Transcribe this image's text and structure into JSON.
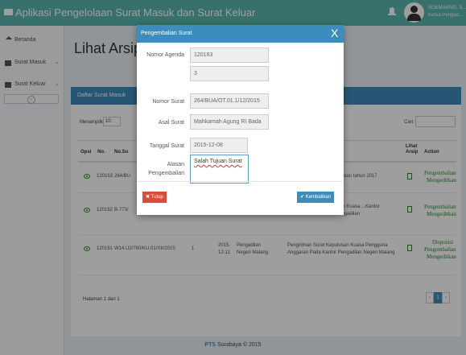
{
  "navbar": {
    "title": "Aplikasi Pengelolaan Surat Masuk dan Surat Keluar",
    "user_name": "SOEMARNO, S....",
    "user_role": "Ketua Pengad..."
  },
  "sidebar": {
    "items": [
      {
        "label": "Beranda"
      },
      {
        "label": "Surat Masuk"
      },
      {
        "label": "Surat Keluar"
      }
    ],
    "toggle": "‹"
  },
  "content": {
    "title": "Lihat Arsip M",
    "box_title": "Daftar Surat Masuk",
    "show_label": "Menampilkan",
    "show_value": "10",
    "search_label": "Cari:",
    "columns": [
      "Opsi",
      "No.",
      "No.Su",
      "Lihat Arsip",
      "Action"
    ],
    "rows": [
      {
        "no": "120163",
        "nomor": "264/BU",
        "perihal": "...gatan tahun 2017",
        "actions": [
          "Pengembalian",
          "Mengeditkan"
        ]
      },
      {
        "no": "120162",
        "nomor": "B-773/",
        "perihal": "...an Kuasa ...Kantor Pengadilan",
        "actions": [
          "Pengembalian",
          "Mengeditkan"
        ]
      },
      {
        "no": "120161",
        "nomor": "W14.U2/760/KU.01/XII/2015",
        "count": "1",
        "date": "2015-12-11",
        "asal": "Pengadilan Negeri Malang",
        "perihal": "Pengiriman Surat Keputusan Kuasa Pengguna Anggaran Pada Kantor Pengadilan Negeri Malang",
        "actions": [
          "Disposisi",
          "Pengembalian",
          "Mengeditkan"
        ]
      }
    ],
    "pager_info": "Halaman 1 dari 1",
    "pager_prev": "‹",
    "pager_current": "1",
    "pager_next": "›"
  },
  "footer": {
    "brand": "PTS",
    "text": "Surabaya © 2015"
  },
  "modal": {
    "title": "Pengembalian Surat",
    "close": "X",
    "fields": [
      {
        "label": "Nomor Agenda",
        "value": "120163"
      },
      {
        "label": "",
        "value": "3"
      },
      {
        "label": "Nomor Surat",
        "value": "264/BUA/OT.01.1/12/2015"
      },
      {
        "label": "Asal Surat",
        "value": "Mahkamah Agung RI Bada"
      },
      {
        "label": "Tanggal Surat",
        "value": "2015-12-08"
      }
    ],
    "reason_label": "Alasan Pengembalian",
    "reason_label_1": "Alasan",
    "reason_label_2": "Pengembalian",
    "reason_value": "Salah Tujuan Surat",
    "close_button": "✖ Tutup",
    "submit_button": "✔ Kembalikan"
  }
}
